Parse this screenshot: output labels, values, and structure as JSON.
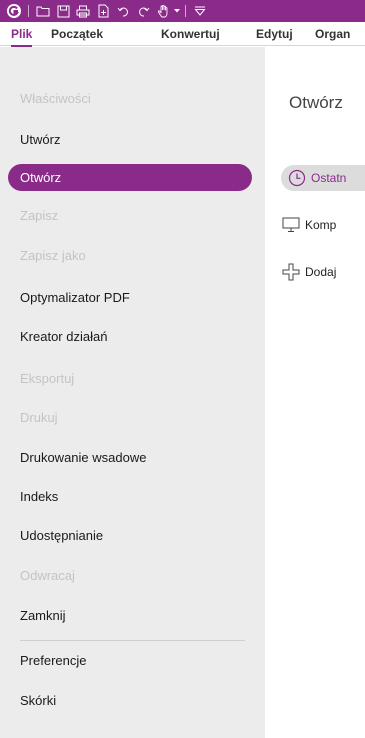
{
  "colors": {
    "accent": "#8a2b8a",
    "nav_bg": "#ececec",
    "selected_pill": "#dcdcdc"
  },
  "quick_access": {
    "icons": [
      "app-logo-icon",
      "open-folder-icon",
      "save-icon",
      "print-icon",
      "new-document-icon",
      "undo-icon",
      "redo-icon",
      "hand-tool-icon",
      "customize-toolbar-icon"
    ]
  },
  "ribbon": {
    "tabs": [
      {
        "label": "Plik",
        "active": true
      },
      {
        "label": "Początek",
        "active": false
      },
      {
        "label": "Konwertuj",
        "active": false
      },
      {
        "label": "Edytuj",
        "active": false
      },
      {
        "label": "Organ",
        "active": false
      }
    ]
  },
  "sidebar": {
    "items": [
      {
        "label": "Właściwości",
        "state": "disabled"
      },
      {
        "label": "Utwórz",
        "state": "normal"
      },
      {
        "label": "Otwórz",
        "state": "selected"
      },
      {
        "label": "Zapisz",
        "state": "disabled"
      },
      {
        "label": "Zapisz jako",
        "state": "disabled"
      },
      {
        "label": "Optymalizator PDF",
        "state": "normal"
      },
      {
        "label": "Kreator działań",
        "state": "normal"
      },
      {
        "label": "Eksportuj",
        "state": "disabled"
      },
      {
        "label": "Drukuj",
        "state": "disabled"
      },
      {
        "label": "Drukowanie wsadowe",
        "state": "normal"
      },
      {
        "label": "Indeks",
        "state": "normal"
      },
      {
        "label": "Udostępnianie",
        "state": "normal"
      },
      {
        "label": "Odwracaj",
        "state": "disabled"
      },
      {
        "label": "Zamknij",
        "state": "normal"
      },
      {
        "label": "Preferencje",
        "state": "normal"
      },
      {
        "label": "Skórki",
        "state": "normal"
      }
    ]
  },
  "main": {
    "title": "Otwórz",
    "locations": [
      {
        "label": "Ostatn",
        "icon": "clock-icon",
        "selected": true
      },
      {
        "label": "Komp",
        "icon": "computer-icon",
        "selected": false
      },
      {
        "label": "Dodaj",
        "icon": "add-place-icon",
        "selected": false
      }
    ]
  }
}
